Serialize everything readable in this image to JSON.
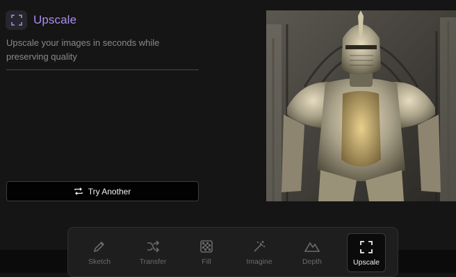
{
  "colors": {
    "accent": "#a98ef0",
    "background": "#151515"
  },
  "header": {
    "icon": "upscale-icon",
    "title": "Upscale"
  },
  "subtitle": "Upscale your images in seconds while preserving quality",
  "try_button": {
    "label": "Try Another",
    "icon": "shuffle-arrows-icon"
  },
  "preview": {
    "description_icon": "image-preview"
  },
  "toolbar": {
    "tools": [
      {
        "label": "Sketch",
        "icon": "pencil-icon",
        "active": false
      },
      {
        "label": "Transfer",
        "icon": "shuffle-icon",
        "active": false
      },
      {
        "label": "Fill",
        "icon": "checkerboard-icon",
        "active": false
      },
      {
        "label": "Imagine",
        "icon": "magic-wand-icon",
        "active": false
      },
      {
        "label": "Depth",
        "icon": "mountain-icon",
        "active": false
      },
      {
        "label": "Upscale",
        "icon": "upscale-icon",
        "active": true
      }
    ]
  }
}
